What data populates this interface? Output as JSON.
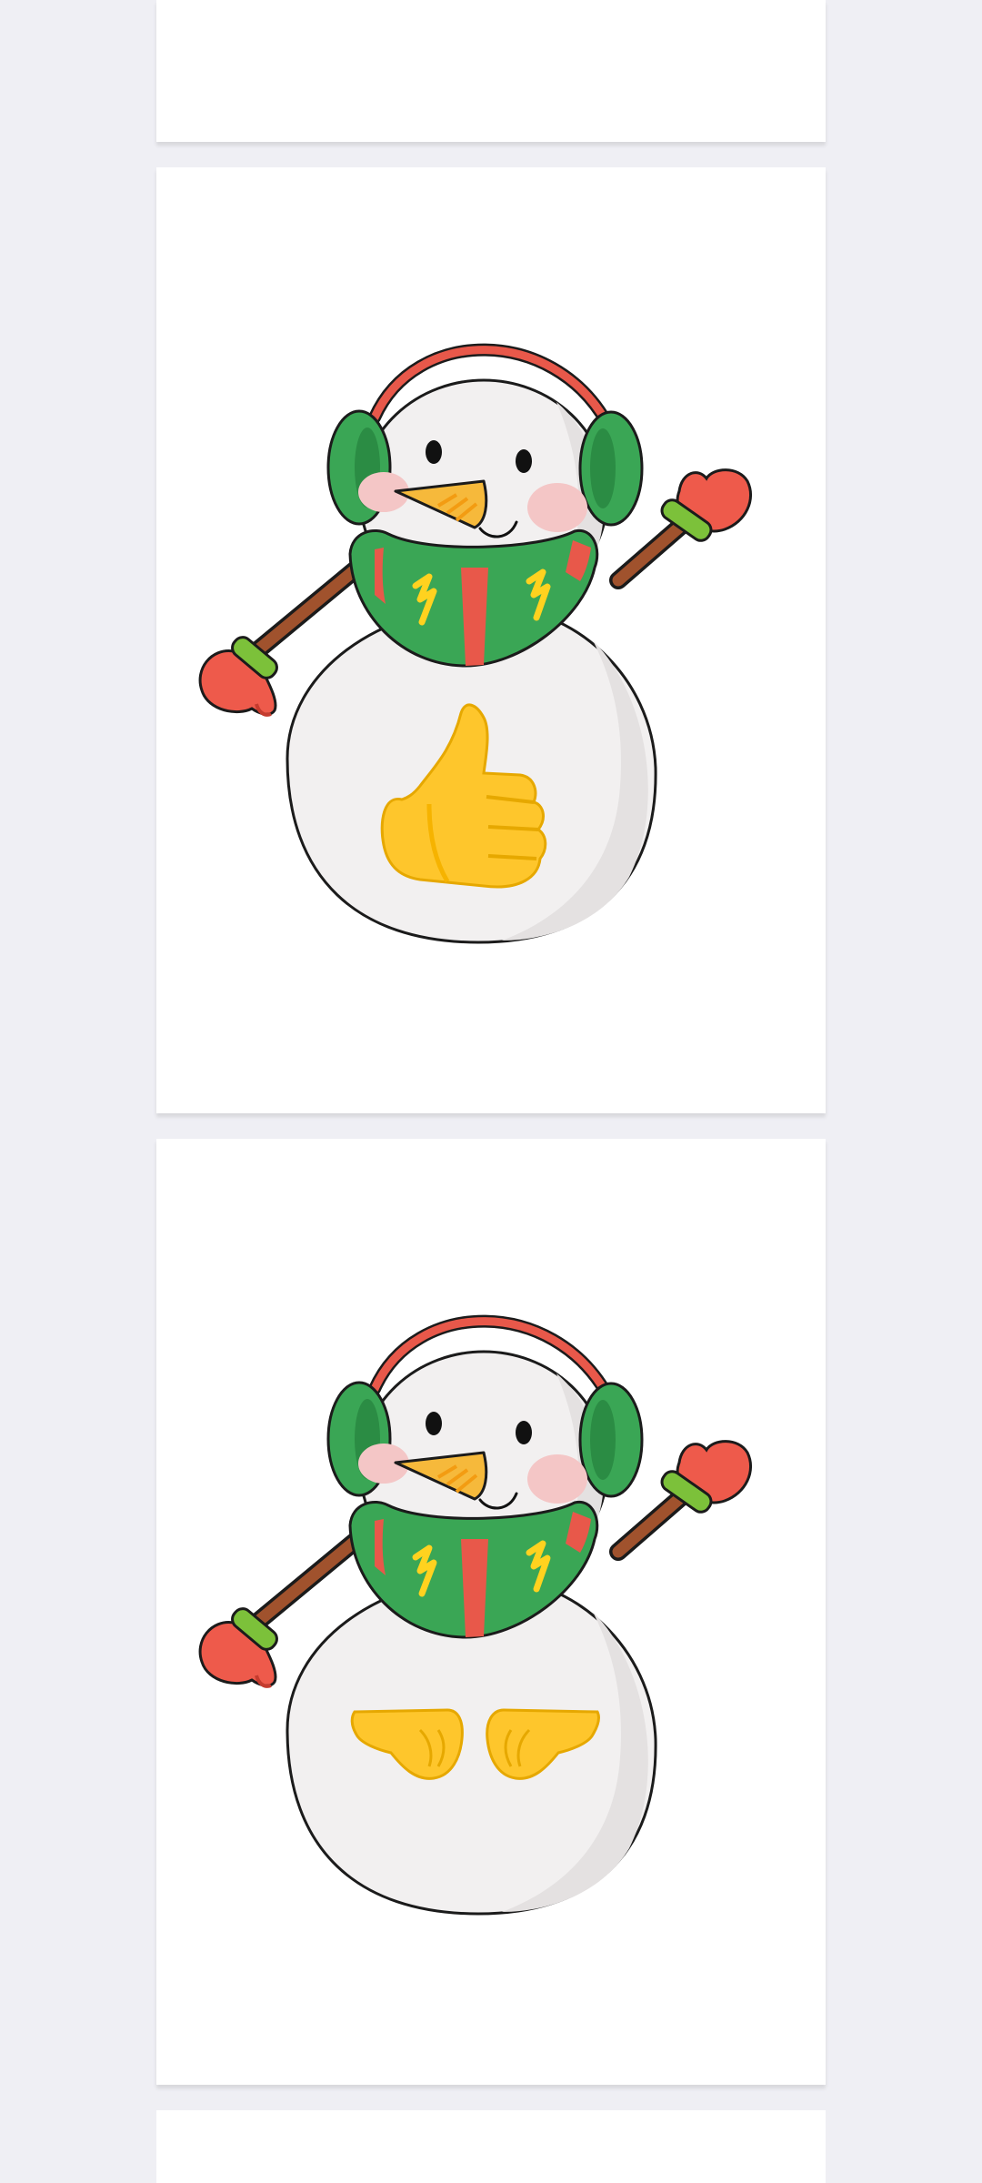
{
  "background_color": "#efeff4",
  "card_color": "#ffffff",
  "stickers": [
    {
      "subject": "snowman",
      "emoji_icon": "thumbs-up-icon"
    },
    {
      "subject": "snowman",
      "emoji_icon": "fist-bump-icon"
    }
  ],
  "colors": {
    "earmuff_band": "#e8584a",
    "earmuff": "#3aa655",
    "scarf_green": "#3aa655",
    "scarf_red": "#e8584a",
    "scarf_zigzag": "#ffd21f",
    "mitten": "#ee5a4b",
    "mitten_cuff": "#7cc13a",
    "arm": "#a0522d",
    "carrot": "#f6b93b",
    "cheek": "#f4c6c6",
    "body": "#f2f0f0",
    "emoji_yellow": "#fec62c"
  }
}
